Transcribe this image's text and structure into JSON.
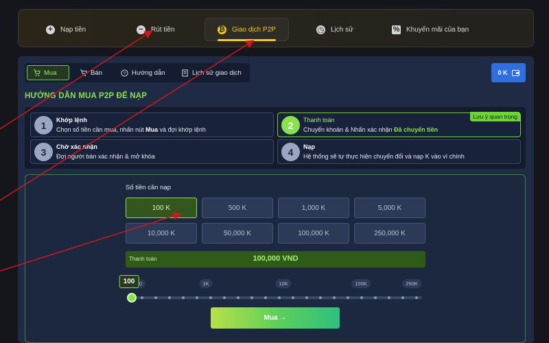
{
  "topnav": {
    "items": [
      {
        "label": "Nạp tiền",
        "icon": "plus-icon"
      },
      {
        "label": "Rút tiền",
        "icon": "minus-icon"
      },
      {
        "label": "Giao dịch P2P",
        "icon": "coin-icon",
        "active": true
      },
      {
        "label": "Lịch sử",
        "icon": "clock-icon"
      },
      {
        "label": "Khuyến mãi của bạn",
        "icon": "discount-icon"
      }
    ]
  },
  "tabs": {
    "items": [
      {
        "label": "Mua",
        "icon": "cart-icon",
        "active": true
      },
      {
        "label": "Bán",
        "icon": "cart-icon"
      },
      {
        "label": "Hướng dẫn",
        "icon": "help-icon"
      },
      {
        "label": "Lịch sử giao dịch",
        "icon": "receipt-icon"
      }
    ]
  },
  "wallet": {
    "balance": "0 K",
    "icon": "wallet-icon"
  },
  "guide": {
    "title": "HƯỚNG DẪN MUA P2P ĐỂ NẠP",
    "steps": [
      {
        "num": "1",
        "title": "Khớp lệnh",
        "desc_pre": "Chọn số tiền cần mua, nhấn nút ",
        "desc_bold": "Mua",
        "desc_post": " và đợi khớp lệnh"
      },
      {
        "num": "2",
        "title": "Thanh toán",
        "desc_pre": "Chuyển khoản & Nhấn xác nhận ",
        "desc_bold": "Đã chuyển tiền",
        "desc_post": "",
        "badge": "Lưu ý quan trọng"
      },
      {
        "num": "3",
        "title": "Chờ xác nhận",
        "desc_pre": "Đợi người bán xác nhận & mở khóa",
        "desc_bold": "",
        "desc_post": ""
      },
      {
        "num": "4",
        "title": "Nạp",
        "desc_pre": "Hệ thống sẽ tự thực hiện chuyển đổi và nạp K vào ví chính",
        "desc_bold": "",
        "desc_post": ""
      }
    ]
  },
  "amount": {
    "label": "Số tiền cần nạp",
    "options": [
      "100 K",
      "500 K",
      "1,000 K",
      "5,000 K",
      "10,000 K",
      "50,000 K",
      "100,000 K",
      "250,000 K"
    ],
    "selected_index": 0,
    "total_label": "Thanh toán",
    "total_value": "100,000 VND",
    "slider": {
      "current": "100",
      "ticks": [
        "0",
        "1K",
        "10K",
        "100K",
        "250K"
      ],
      "value_fraction": 0
    },
    "buy_label": "Mua →"
  },
  "colors": {
    "accent": "#8be04e",
    "gold": "#f5c52a",
    "wallet": "#2f6fe0",
    "arrow": "#d01818"
  }
}
